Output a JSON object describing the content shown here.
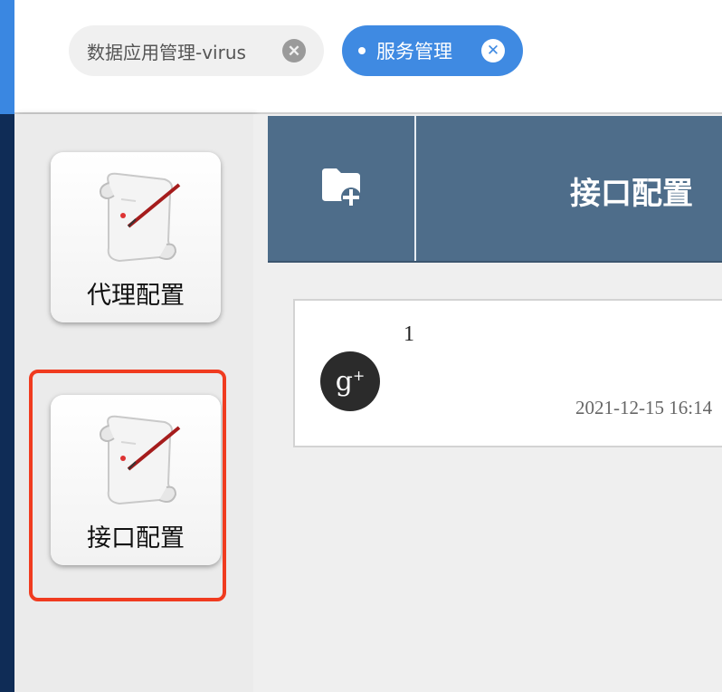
{
  "tabs": [
    {
      "label": "数据应用管理-virus",
      "active": false,
      "close_icon": "close-circle-icon"
    },
    {
      "label": "服务管理",
      "active": true,
      "close_icon": "close-circle-icon"
    }
  ],
  "sidebar": {
    "items": [
      {
        "label": "代理配置",
        "icon": "scroll-quill-icon",
        "selected": false
      },
      {
        "label": "接口配置",
        "icon": "scroll-quill-icon",
        "selected": true
      }
    ]
  },
  "main": {
    "header": {
      "title": "接口配置",
      "add_icon": "folder-add-icon"
    },
    "cards": [
      {
        "name": "1",
        "timestamp": "2021-12-15 16:14",
        "avatar_icon": "google-plus-icon",
        "avatar_text": "g",
        "avatar_sup": "+"
      }
    ]
  },
  "colors": {
    "accent_blue": "#3f8ae2",
    "header_bar": "#4e6d8a",
    "left_strip": "#0f2c56",
    "highlight_border": "#f03b1f"
  }
}
